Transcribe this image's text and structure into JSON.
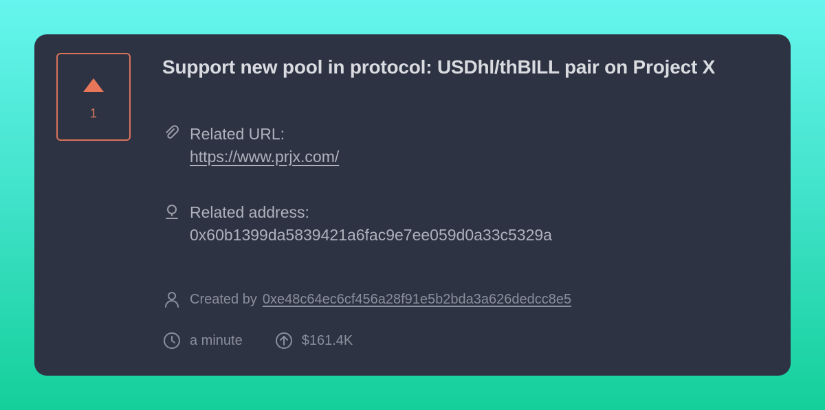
{
  "vote": {
    "count": "1"
  },
  "proposal": {
    "title": "Support new pool in protocol: USDhl/thBILL pair on Project X",
    "related_url_label": "Related URL:",
    "related_url": "https://www.prjx.com/",
    "related_address_label": "Related address:",
    "related_address": "0x60b1399da5839421a6fac9e7ee059d0a33c5329a",
    "created_by_label": "Created by",
    "creator_address": "0xe48c64ec6cf456a28f91e5b2bda3a626dedcc8e5",
    "time_ago": "a minute",
    "amount": "$161.4K"
  },
  "colors": {
    "accent": "#e07c5f",
    "card_bg": "#2e3343",
    "text_primary": "#d9dbe0",
    "text_secondary": "#aeb2bd",
    "text_muted": "#8a8f9c"
  },
  "icons": {
    "upvote": "triangle-up-icon",
    "url": "paperclip-icon",
    "address": "location-pin-icon",
    "creator": "user-icon",
    "time": "clock-icon",
    "amount": "arrow-up-circle-icon"
  }
}
